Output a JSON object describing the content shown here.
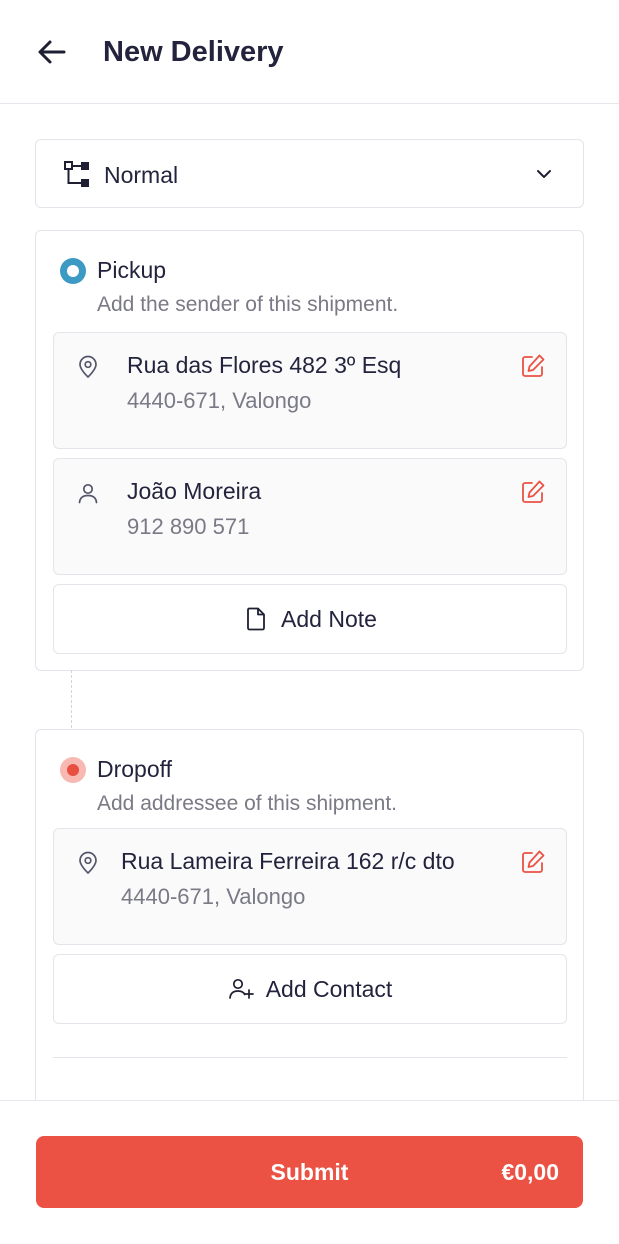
{
  "header": {
    "title": "New Delivery",
    "back_icon": "arrow-left-icon"
  },
  "delivery_type": {
    "selected": "Normal",
    "icon": "hierarchy-icon",
    "chevron": "chevron-down-icon"
  },
  "pickup": {
    "title": "Pickup",
    "subtitle": "Add the sender of this shipment.",
    "address": {
      "line1": "Rua das Flores 482 3º Esq",
      "line2": "4440-671, Valongo",
      "icon": "location-pin-icon"
    },
    "contact": {
      "name": "João Moreira",
      "phone": "912 890 571",
      "icon": "user-icon"
    },
    "add_note_label": "Add Note"
  },
  "dropoff": {
    "title": "Dropoff",
    "subtitle": "Add addressee of this shipment.",
    "address": {
      "line1": "Rua Lameira Ferreira 162 r/c dto",
      "line2": "4440-671, Valongo",
      "icon": "location-pin-icon"
    },
    "add_contact_label": "Add Contact"
  },
  "footer": {
    "submit_label": "Submit",
    "price": "€0,00"
  },
  "colors": {
    "accent": "#eb5244",
    "pickup_dot": "#3d9ac4",
    "dropoff_dot": "#e94f41",
    "text_primary": "#23233d",
    "text_secondary": "#7a7a86",
    "border": "#e4e4ea"
  }
}
